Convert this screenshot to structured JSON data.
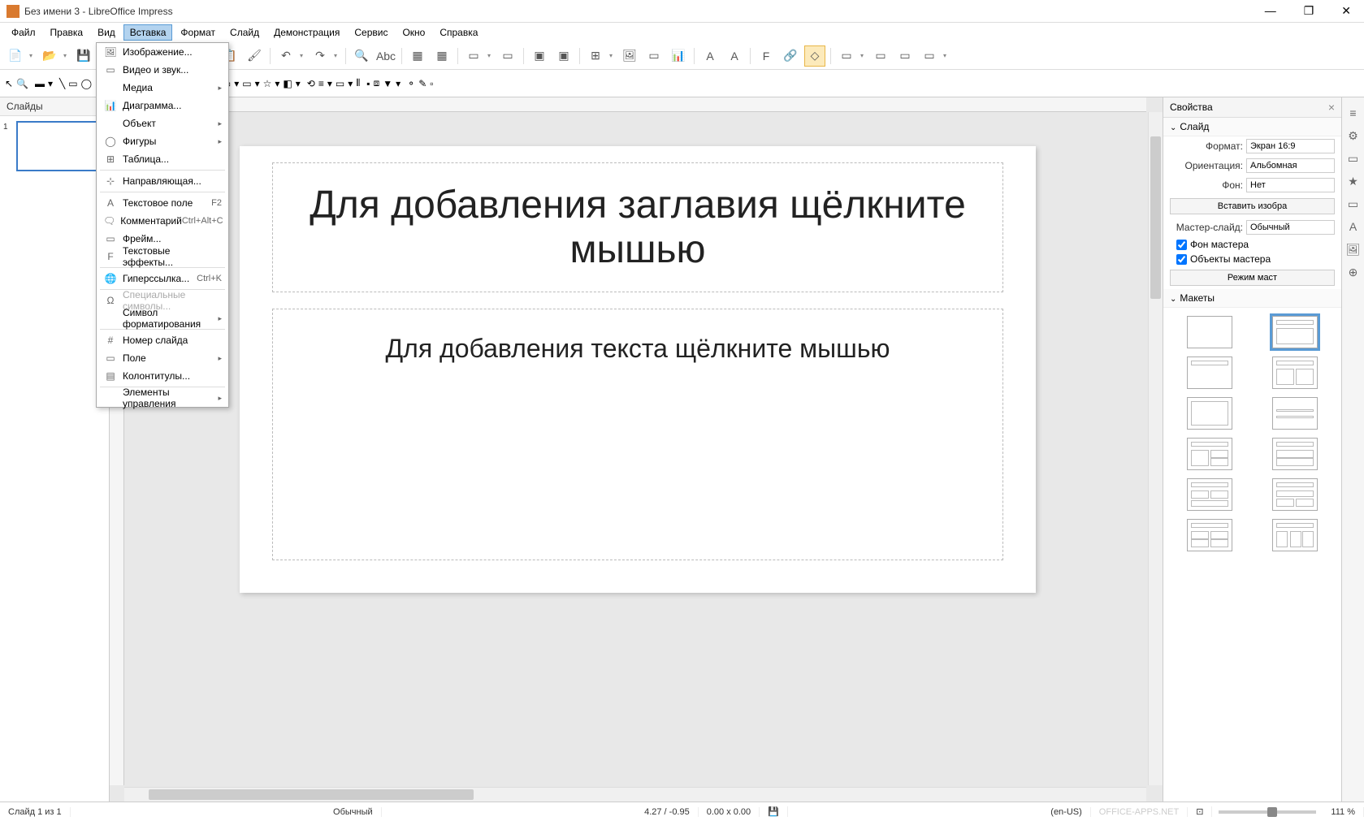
{
  "window": {
    "title": "Без имени 3 - LibreOffice Impress"
  },
  "menubar": [
    {
      "label": "Файл",
      "ul": "Ф"
    },
    {
      "label": "Правка",
      "ul": "П"
    },
    {
      "label": "Вид",
      "ul": "В"
    },
    {
      "label": "Вставка",
      "ul": "с",
      "active": true
    },
    {
      "label": "Формат",
      "ul": "Ф"
    },
    {
      "label": "Слайд",
      "ul": "С"
    },
    {
      "label": "Демонстрация",
      "ul": "Д"
    },
    {
      "label": "Сервис",
      "ul": "е"
    },
    {
      "label": "Окно",
      "ul": "О"
    },
    {
      "label": "Справка",
      "ul": "п"
    }
  ],
  "dropdown": {
    "groups": [
      [
        {
          "icon": "image",
          "label": "Изображение...",
          "shortcut": ""
        },
        {
          "icon": "video",
          "label": "Видео и звук...",
          "shortcut": ""
        },
        {
          "icon": "media",
          "label": "Медиа",
          "submenu": true
        },
        {
          "icon": "chart",
          "label": "Диаграмма...",
          "shortcut": ""
        },
        {
          "icon": "object",
          "label": "Объект",
          "submenu": true
        },
        {
          "icon": "shapes",
          "label": "Фигуры",
          "submenu": true
        },
        {
          "icon": "table",
          "label": "Таблица...",
          "shortcut": ""
        }
      ],
      [
        {
          "icon": "guide",
          "label": "Направляющая...",
          "shortcut": ""
        }
      ],
      [
        {
          "icon": "textbox",
          "label": "Текстовое поле",
          "shortcut": "F2"
        },
        {
          "icon": "comment",
          "label": "Комментарий",
          "shortcut": "Ctrl+Alt+C"
        },
        {
          "icon": "frame",
          "label": "Фрейм...",
          "shortcut": ""
        },
        {
          "icon": "tfx",
          "label": "Текстовые эффекты...",
          "shortcut": ""
        }
      ],
      [
        {
          "icon": "link",
          "label": "Гиперссылка...",
          "shortcut": "Ctrl+K"
        }
      ],
      [
        {
          "icon": "omega",
          "label": "Специальные символы...",
          "disabled": true
        },
        {
          "icon": "format",
          "label": "Символ форматирования",
          "submenu": true
        }
      ],
      [
        {
          "icon": "slidenum",
          "label": "Номер слайда",
          "shortcut": ""
        },
        {
          "icon": "field",
          "label": "Поле",
          "submenu": true
        },
        {
          "icon": "hf",
          "label": "Колонтитулы...",
          "shortcut": ""
        }
      ],
      [
        {
          "icon": "controls",
          "label": "Элементы управления",
          "submenu": true
        }
      ]
    ]
  },
  "slides_panel": {
    "title": "Слайды",
    "items": [
      {
        "num": "1"
      }
    ]
  },
  "slide_content": {
    "title_placeholder": "Для добавления заглавия щёлкните мышью",
    "body_placeholder": "Для добавления текста щёлкните мышью"
  },
  "properties": {
    "panel_title": "Свойства",
    "slide_section": "Слайд",
    "format_label": "Формат:",
    "format_value": "Экран 16:9",
    "orientation_label": "Ориентация:",
    "orientation_value": "Альбомная",
    "background_label": "Фон:",
    "background_value": "Нет",
    "insert_image_btn": "Вставить изобра",
    "master_label": "Мастер-слайд:",
    "master_value": "Обычный",
    "master_bg_check": "Фон мастера",
    "master_obj_check": "Объекты мастера",
    "master_mode_btn": "Режим маст",
    "layouts_section": "Макеты"
  },
  "statusbar": {
    "slide_info": "Слайд 1 из 1",
    "master": "Обычный",
    "coords": "4.27 / -0.95",
    "size": "0.00 x 0.00",
    "lang": "(en-US)",
    "zoom": "111 %",
    "watermark": "OFFICE-APPS.NET"
  }
}
